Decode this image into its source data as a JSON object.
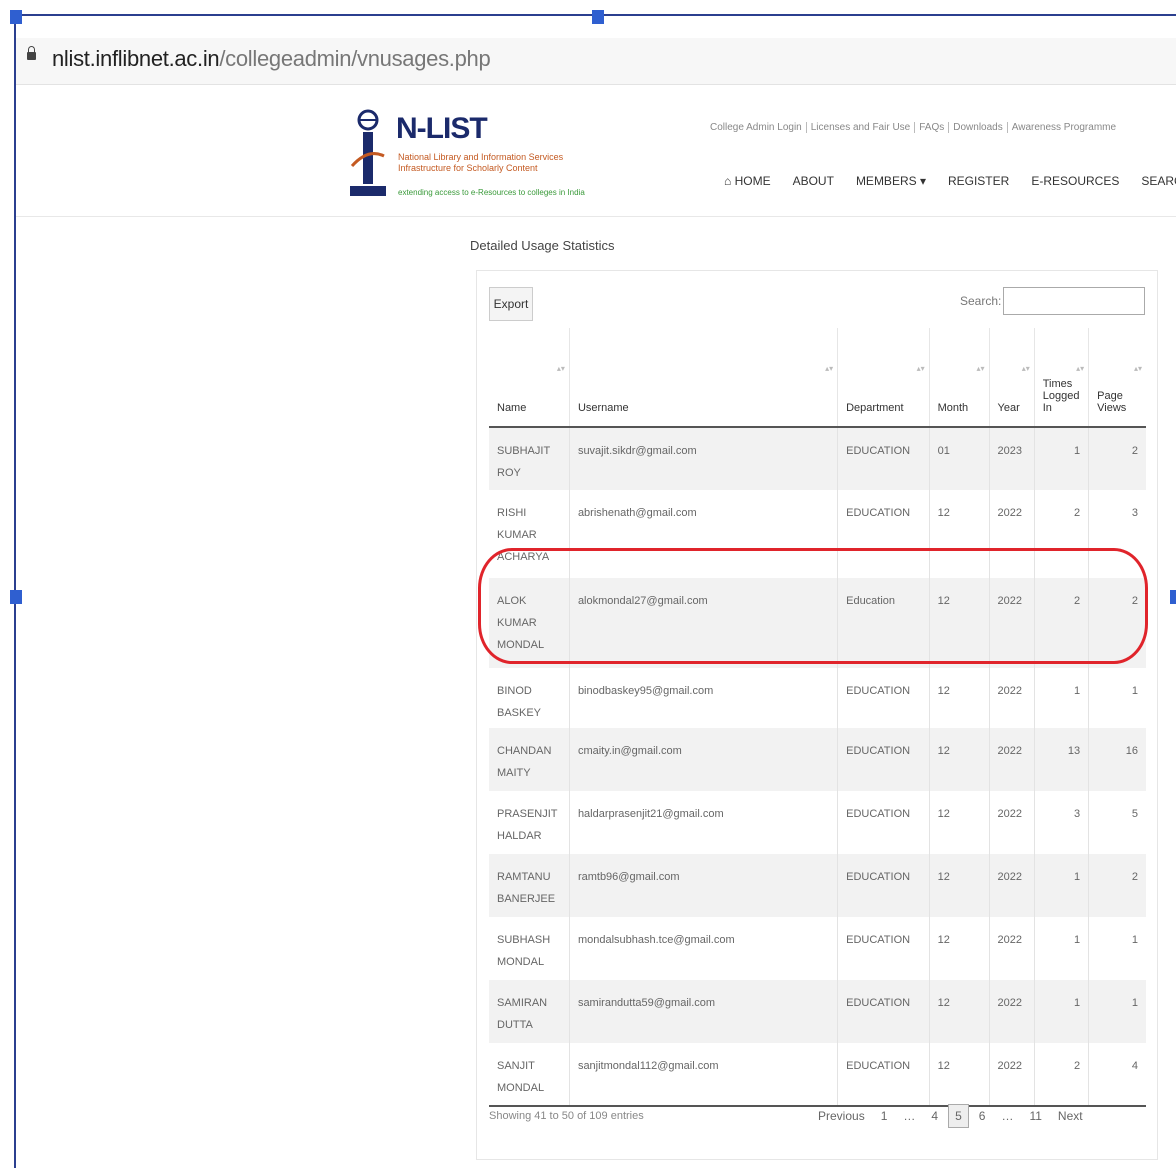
{
  "browser": {
    "url_host": "nlist.inflibnet.ac.in",
    "url_path": "/collegeadmin/vnusages.php"
  },
  "header": {
    "logo_title": "N-LIST",
    "logo_subtitle_1": "National Library and Information Services",
    "logo_subtitle_2": "Infrastructure for Scholarly Content",
    "logo_tagline": "extending access to e-Resources to colleges in India",
    "top_links": [
      "College Admin Login",
      "Licenses and Fair Use",
      "FAQs",
      "Downloads",
      "Awareness Programme"
    ],
    "nav": [
      "⌂ HOME",
      "ABOUT",
      "MEMBERS ▾",
      "REGISTER",
      "E-RESOURCES",
      "SEARCH"
    ]
  },
  "panel": {
    "title": "Detailed Usage Statistics",
    "export_label": "Export",
    "search_label": "Search:",
    "search_value": ""
  },
  "table": {
    "columns": [
      "Name",
      "Username",
      "Department",
      "Month",
      "Year",
      "Times Logged In",
      "Page Views"
    ],
    "rows": [
      {
        "name": "SUBHAJIT ROY",
        "username": "suvajit.sikdr@gmail.com",
        "department": "EDUCATION",
        "month": "01",
        "year": "2023",
        "logged": "1",
        "views": "2"
      },
      {
        "name": "RISHI KUMAR ACHARYA",
        "username": "abrishenath@gmail.com",
        "department": "EDUCATION",
        "month": "12",
        "year": "2022",
        "logged": "2",
        "views": "3"
      },
      {
        "name": "ALOK KUMAR MONDAL",
        "username": "alokmondal27@gmail.com",
        "department": "Education",
        "month": "12",
        "year": "2022",
        "logged": "2",
        "views": "2"
      },
      {
        "name": "BINOD BASKEY",
        "username": "binodbaskey95@gmail.com",
        "department": "EDUCATION",
        "month": "12",
        "year": "2022",
        "logged": "1",
        "views": "1"
      },
      {
        "name": "CHANDAN MAITY",
        "username": "cmaity.in@gmail.com",
        "department": "EDUCATION",
        "month": "12",
        "year": "2022",
        "logged": "13",
        "views": "16"
      },
      {
        "name": "PRASENJIT HALDAR",
        "username": "haldarprasenjit21@gmail.com",
        "department": "EDUCATION",
        "month": "12",
        "year": "2022",
        "logged": "3",
        "views": "5"
      },
      {
        "name": "RAMTANU BANERJEE",
        "username": "ramtb96@gmail.com",
        "department": "EDUCATION",
        "month": "12",
        "year": "2022",
        "logged": "1",
        "views": "2"
      },
      {
        "name": "SUBHASH MONDAL",
        "username": "mondalsubhash.tce@gmail.com",
        "department": "EDUCATION",
        "month": "12",
        "year": "2022",
        "logged": "1",
        "views": "1"
      },
      {
        "name": "SAMIRAN DUTTA",
        "username": "samirandutta59@gmail.com",
        "department": "EDUCATION",
        "month": "12",
        "year": "2022",
        "logged": "1",
        "views": "1"
      },
      {
        "name": "SANJIT MONDAL",
        "username": "sanjitmondal112@gmail.com",
        "department": "EDUCATION",
        "month": "12",
        "year": "2022",
        "logged": "2",
        "views": "4"
      }
    ]
  },
  "footer": {
    "info": "Showing 41 to 50 of 109 entries",
    "pager": [
      "Previous",
      "1",
      "…",
      "4",
      "5",
      "6",
      "…",
      "11",
      "Next"
    ],
    "active_page": "5"
  },
  "colors": {
    "highlight": "#e0242b",
    "frame": "#2b3f8f",
    "handle": "#2f5fd0",
    "logo": "#1b2a6b"
  }
}
